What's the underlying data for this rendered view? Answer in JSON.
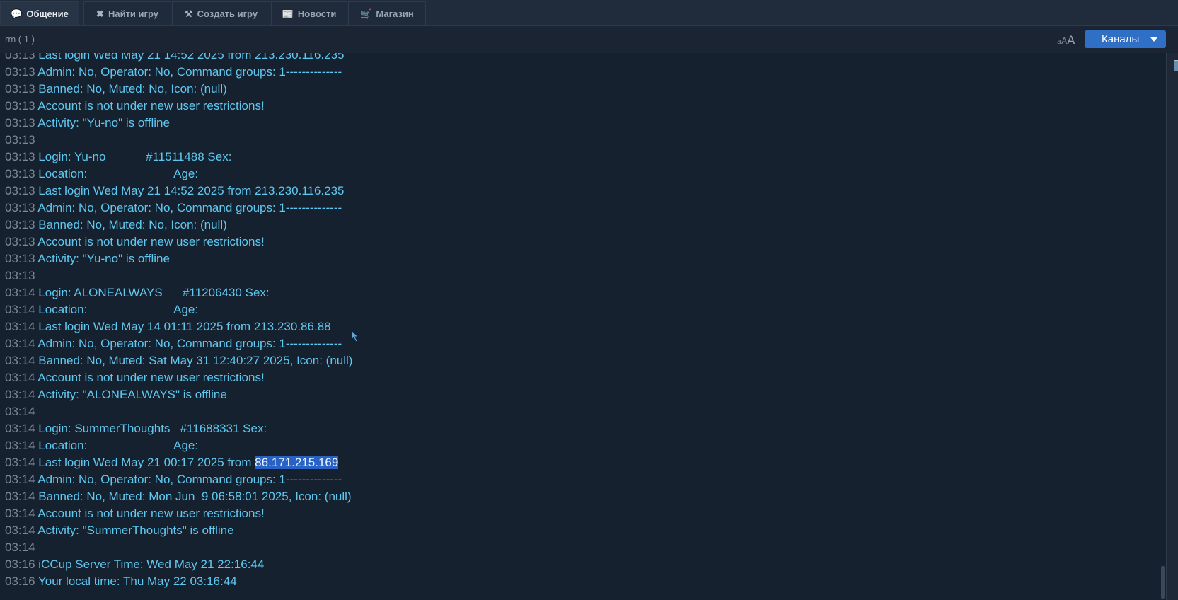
{
  "tabs": [
    {
      "label": "Общение",
      "icon": "💬"
    },
    {
      "label": "Найти игру",
      "icon": "✖"
    },
    {
      "label": "Создать игру",
      "icon": "⚒"
    },
    {
      "label": "Новости",
      "icon": "📰"
    },
    {
      "label": "Магазин",
      "icon": "🛒"
    }
  ],
  "room": {
    "name": "rm",
    "count": "( 1 )"
  },
  "font_size_control": {
    "small": "a",
    "medium": "A",
    "large": "A"
  },
  "channels_button": {
    "label": "Каналы"
  },
  "chat": {
    "lines": [
      {
        "time": "03:13",
        "text": "Last login Wed May 21 14:52 2025 from 213.230.116.235"
      },
      {
        "time": "03:13",
        "text": "Admin: No, Operator: No, Command groups: 1--------------"
      },
      {
        "time": "03:13",
        "text": "Banned: No, Muted: No, Icon: (null)"
      },
      {
        "time": "03:13",
        "text": "Account is not under new user restrictions!"
      },
      {
        "time": "03:13",
        "text": "Activity: \"Yu-no\" is offline"
      },
      {
        "time": "03:13",
        "text": ""
      },
      {
        "time": "03:13",
        "text": "Login: Yu-no            #11511488 Sex:"
      },
      {
        "time": "03:13",
        "text": "Location:                          Age:"
      },
      {
        "time": "03:13",
        "text": "Last login Wed May 21 14:52 2025 from 213.230.116.235"
      },
      {
        "time": "03:13",
        "text": "Admin: No, Operator: No, Command groups: 1--------------"
      },
      {
        "time": "03:13",
        "text": "Banned: No, Muted: No, Icon: (null)"
      },
      {
        "time": "03:13",
        "text": "Account is not under new user restrictions!"
      },
      {
        "time": "03:13",
        "text": "Activity: \"Yu-no\" is offline"
      },
      {
        "time": "03:13",
        "text": ""
      },
      {
        "time": "03:14",
        "text": "Login: ALONEALWAYS      #11206430 Sex:"
      },
      {
        "time": "03:14",
        "text": "Location:                          Age:"
      },
      {
        "time": "03:14",
        "text": "Last login Wed May 14 01:11 2025 from 213.230.86.88"
      },
      {
        "time": "03:14",
        "text": "Admin: No, Operator: No, Command groups: 1--------------"
      },
      {
        "time": "03:14",
        "text": "Banned: No, Muted: Sat May 31 12:40:27 2025, Icon: (null)"
      },
      {
        "time": "03:14",
        "text": "Account is not under new user restrictions!"
      },
      {
        "time": "03:14",
        "text": "Activity: \"ALONEALWAYS\" is offline"
      },
      {
        "time": "03:14",
        "text": ""
      },
      {
        "time": "03:14",
        "text": "Login: SummerThoughts   #11688331 Sex:"
      },
      {
        "time": "03:14",
        "text": "Location:                          Age:"
      },
      {
        "time": "03:14",
        "text": "Last login Wed May 21 00:17 2025 from ",
        "selected": "86.171.215.169"
      },
      {
        "time": "03:14",
        "text": "Admin: No, Operator: No, Command groups: 1--------------"
      },
      {
        "time": "03:14",
        "text": "Banned: No, Muted: Mon Jun  9 06:58:01 2025, Icon: (null)"
      },
      {
        "time": "03:14",
        "text": "Account is not under new user restrictions!"
      },
      {
        "time": "03:14",
        "text": "Activity: \"SummerThoughts\" is offline"
      },
      {
        "time": "03:14",
        "text": ""
      },
      {
        "time": "03:16",
        "text": "iCCup Server Time: Wed May 21 22:16:44"
      },
      {
        "time": "03:16",
        "text": "Your local time: Thu May 22 03:16:44"
      }
    ]
  }
}
